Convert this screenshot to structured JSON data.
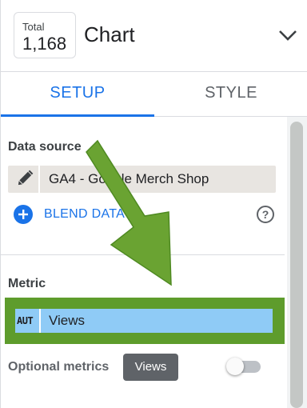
{
  "header": {
    "scorecard": {
      "label": "Total",
      "value": "1,168"
    },
    "title": "Chart",
    "collapse_icon": "chevron-down-icon"
  },
  "tabs": [
    {
      "label": "SETUP",
      "active": true
    },
    {
      "label": "STYLE",
      "active": false
    }
  ],
  "data_source": {
    "section_label": "Data source",
    "edit_icon": "pencil-icon",
    "name": "GA4 - Google Merch Shop",
    "blend_label": "BLEND DATA",
    "blend_icon": "add-circle-icon",
    "help_icon": "help-circle-icon",
    "help_glyph": "?"
  },
  "metric": {
    "section_label": "Metric",
    "type_badge": "AUT",
    "name": "Views"
  },
  "optional_metrics": {
    "label": "Optional metrics",
    "chip_label": "Views",
    "toggle_on": false
  },
  "colors": {
    "accent": "#1a73e8",
    "annotation_green": "#5e9c2c",
    "metric_fill": "#8fcbf6"
  }
}
